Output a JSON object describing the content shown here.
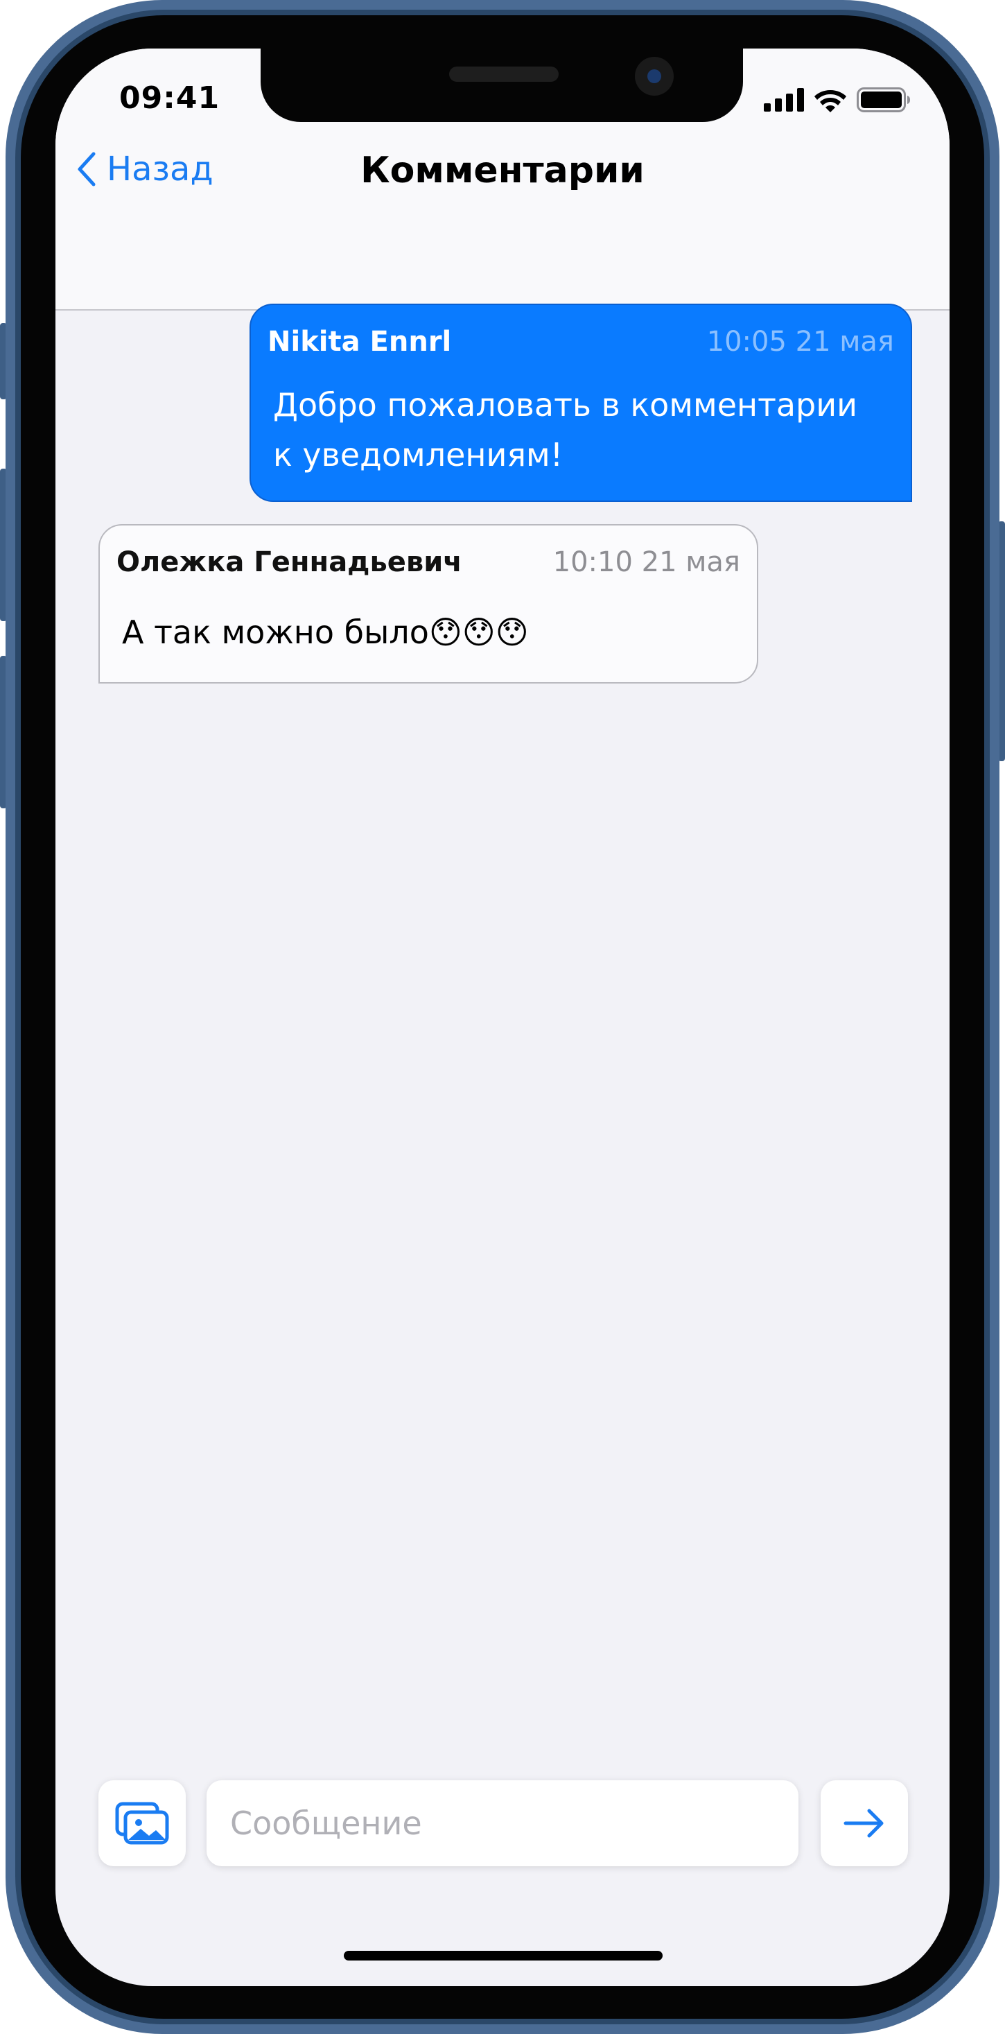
{
  "status_bar": {
    "time": "09:41",
    "icons": [
      "cellular-signal-icon",
      "wifi-icon",
      "battery-icon"
    ]
  },
  "nav": {
    "back_label": "Назад",
    "title": "Комментарии"
  },
  "messages": [
    {
      "direction": "outgoing",
      "author": "Nikita Ennrl",
      "timestamp": "10:05 21 мая",
      "text": "Добро пожаловать в комментарии к уведомлениям!"
    },
    {
      "direction": "incoming",
      "author": "Олежка Геннадьевич",
      "timestamp": "10:10 21 мая",
      "text": "А так можно было😯😯😯"
    }
  ],
  "composer": {
    "placeholder": "Сообщение",
    "value": "",
    "attach_icon": "photo-gallery-icon",
    "send_icon": "arrow-right-icon"
  },
  "colors": {
    "accent": "#0a7bff",
    "screen_background": "#f2f2f7",
    "frame": "#4a6b94"
  }
}
